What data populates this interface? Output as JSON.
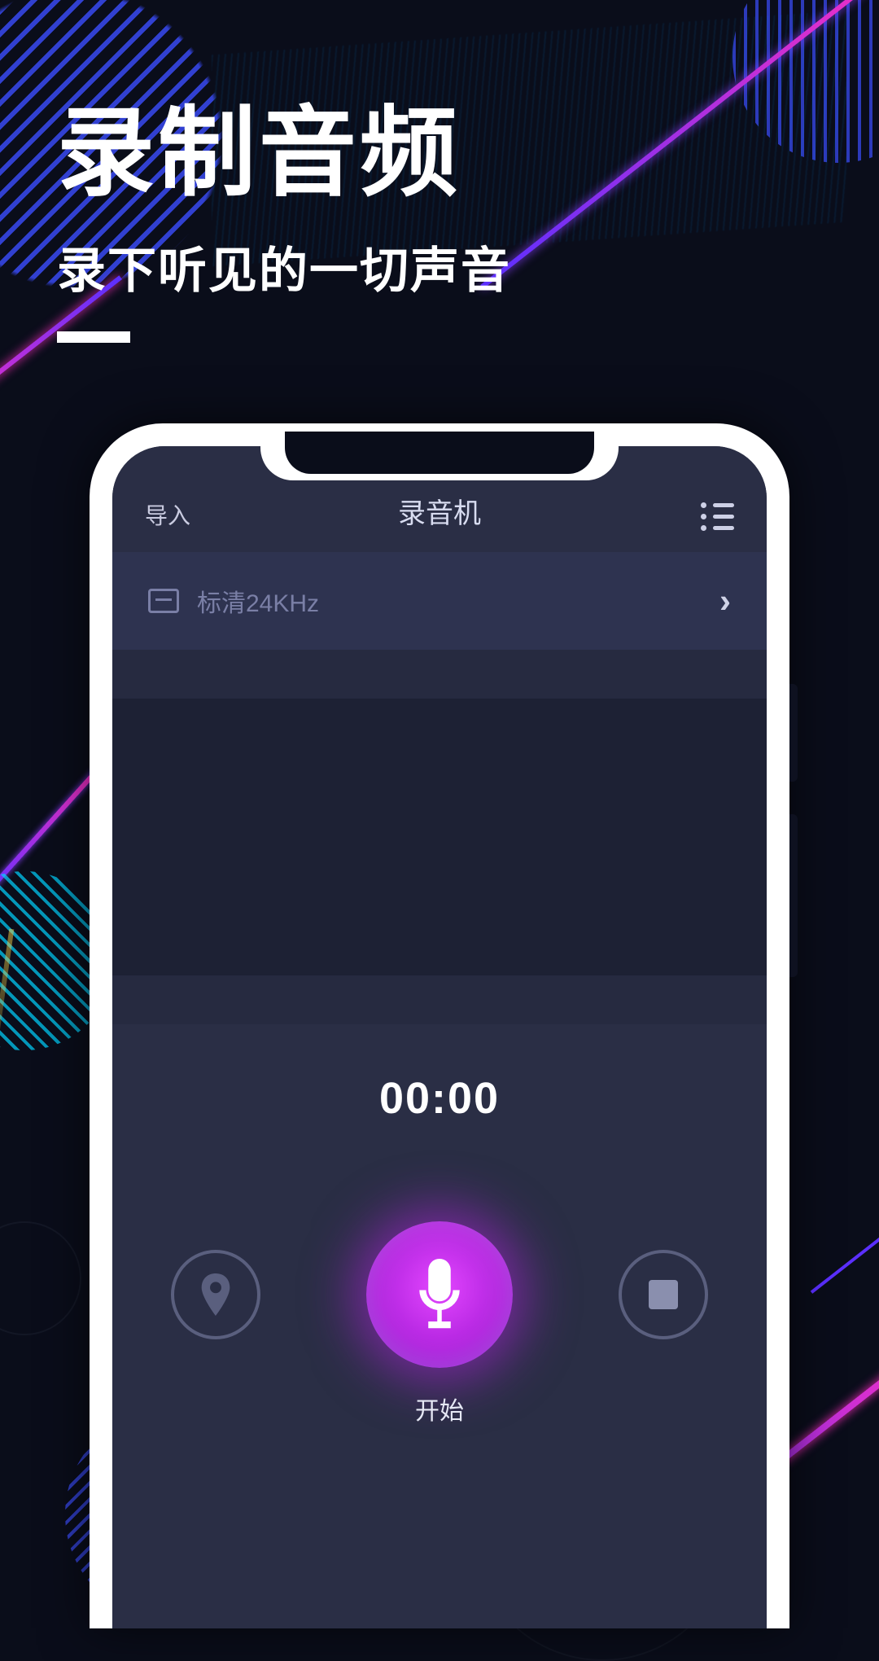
{
  "hero": {
    "title": "录制音频",
    "subtitle": "录下听见的一切声音"
  },
  "navbar": {
    "import_label": "导入",
    "title": "录音机"
  },
  "quality": {
    "label": "标清24KHz"
  },
  "recorder": {
    "timer": "00:00",
    "start_label": "开始"
  }
}
